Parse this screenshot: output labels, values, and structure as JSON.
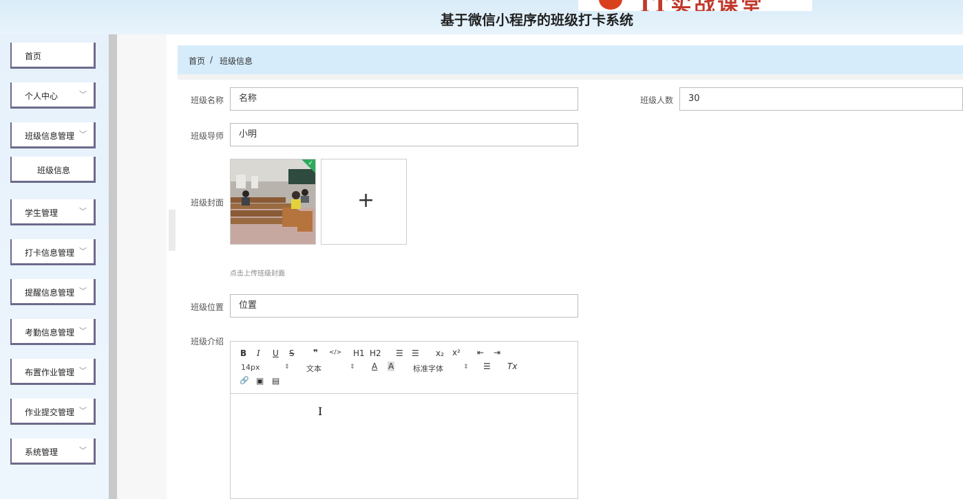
{
  "header": {
    "app_title": "基于微信小程序的班级打卡系统",
    "logo_text": "IT实战课堂"
  },
  "sidebar": {
    "items": [
      {
        "label": "首页",
        "has_chevron": false
      },
      {
        "label": "个人中心",
        "has_chevron": true
      },
      {
        "label": "班级信息管理",
        "has_chevron": true
      },
      {
        "label": "班级信息",
        "has_chevron": false,
        "sub": true
      },
      {
        "label": "学生管理",
        "has_chevron": true
      },
      {
        "label": "打卡信息管理",
        "has_chevron": true
      },
      {
        "label": "提醒信息管理",
        "has_chevron": true
      },
      {
        "label": "考勤信息管理",
        "has_chevron": true
      },
      {
        "label": "布置作业管理",
        "has_chevron": true
      },
      {
        "label": "作业提交管理",
        "has_chevron": true
      },
      {
        "label": "系统管理",
        "has_chevron": true
      }
    ],
    "chevron_icon": "chevron-down-icon"
  },
  "breadcrumb": {
    "home": "首页",
    "separator": "/",
    "current": "班级信息"
  },
  "form": {
    "class_name": {
      "label": "班级名称",
      "value": "名称"
    },
    "class_size": {
      "label": "班级人数",
      "value": "30"
    },
    "class_tutor": {
      "label": "班级导师",
      "value": "小明"
    },
    "class_cover": {
      "label": "班级封面",
      "hint": "点击上传班级封面",
      "upload_icon": "plus-icon"
    },
    "class_location": {
      "label": "班级位置",
      "value": "位置"
    },
    "class_intro": {
      "label": "班级介绍"
    }
  },
  "editor": {
    "buttons": {
      "bold": "B",
      "italic": "I",
      "underline": "U",
      "strike": "S",
      "blockquote": "❞",
      "code": "</>",
      "h1": "H1",
      "h2": "H2",
      "list_ordered": "☰",
      "list_bullet": "☰",
      "subscript": "x₂",
      "superscript": "x²",
      "outdent": "⇤",
      "indent": "⇥",
      "color": "A",
      "background": "A",
      "align": "☰",
      "clean": "Tx",
      "link": "🔗",
      "image": "▣",
      "video": "▤"
    },
    "size_select": "14px",
    "header_select": "文本",
    "font_select": "标准字体"
  },
  "colors": {
    "accent_sidebar_border": "#6c6a8a",
    "breadcrumb_bg": "#d6ecfa",
    "check_green": "#2eaa5c"
  }
}
